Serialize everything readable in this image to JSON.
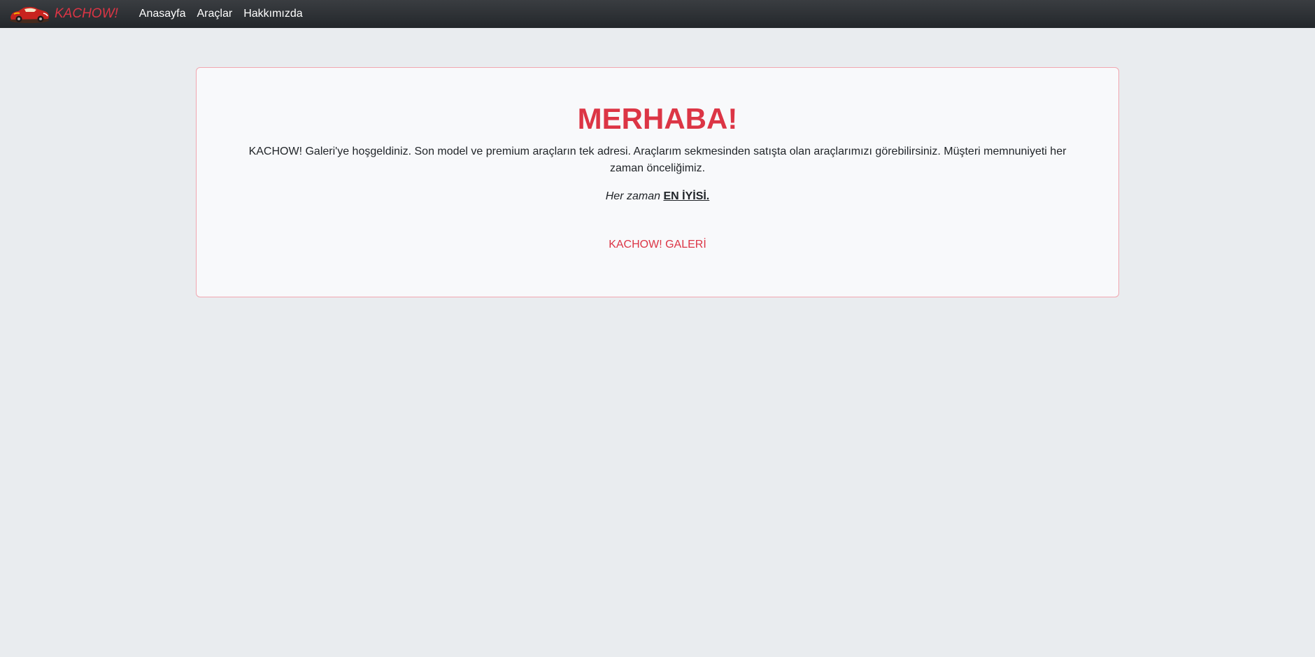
{
  "navbar": {
    "brand_text": "KACHOW!",
    "logo_icon": "race-car-icon",
    "links": [
      {
        "label": "Anasayfa"
      },
      {
        "label": "Araçlar"
      },
      {
        "label": "Hakkımızda"
      }
    ]
  },
  "hero": {
    "title": "MERHABA!",
    "description": "KACHOW! Galeri'ye hoşgeldiniz. Son model ve premium araçların tek adresi. Araçlarım sekmesinden satışta olan araçlarımızı görebilirsiniz. Müşteri memnuniyeti her zaman önceliğimiz.",
    "motto_prefix": "Her zaman",
    "motto_emphasis": "EN İYİSİ.",
    "gallery_link": "KACHOW! GALERİ"
  },
  "colors": {
    "accent": "#dc3545",
    "navbar_bg": "#343a40",
    "page_bg": "#e9ecef",
    "card_border": "#f1a7b0"
  }
}
